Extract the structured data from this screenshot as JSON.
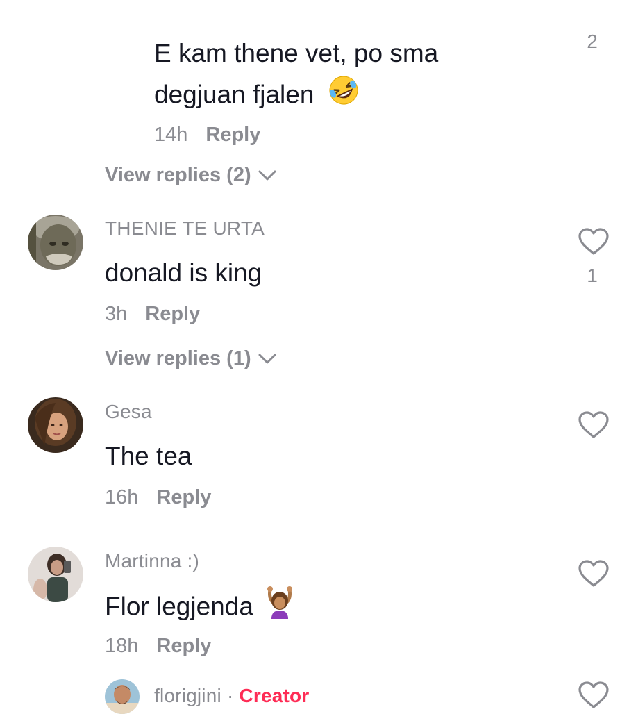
{
  "comments": [
    {
      "text_line1": "E kam thene vet, po sma",
      "text_line2": "degjuan fjalen",
      "emoji": "rolling-on-floor-laughing-emoji",
      "time": "14h",
      "reply_label": "Reply",
      "view_replies": "View replies (2)",
      "likes": "2"
    },
    {
      "username": "THENIE TE URTA",
      "text": "donald is king",
      "time": "3h",
      "reply_label": "Reply",
      "view_replies": "View replies (1)",
      "likes": "1"
    },
    {
      "username": "Gesa",
      "text": "The tea",
      "time": "16h",
      "reply_label": "Reply"
    },
    {
      "username": "Martinna :)",
      "text": "Flor legjenda",
      "emoji": "woman-gesturing-ok-emoji",
      "time": "18h",
      "reply_label": "Reply"
    },
    {
      "username": "florigjini",
      "separator": "·",
      "badge": "Creator"
    }
  ],
  "colors": {
    "muted": "#8a8b91",
    "text": "#161823",
    "creator": "#fe2c55"
  }
}
